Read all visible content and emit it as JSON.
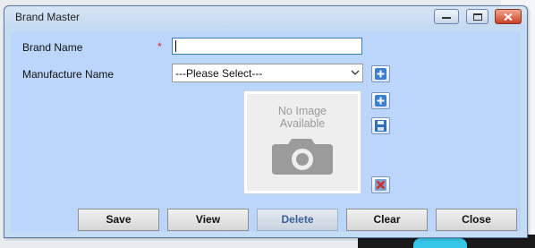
{
  "window": {
    "title": "Brand Master",
    "controls": [
      "minimize-icon",
      "maximize-icon",
      "close-icon"
    ]
  },
  "form": {
    "brand_name_label": "Brand Name",
    "required_marker": "*",
    "brand_name_value": "",
    "manufacture_label": "Manufacture Name",
    "manufacture_selected": "---Please Select---",
    "image_placeholder_line1": "No Image",
    "image_placeholder_line2": "Available"
  },
  "buttons": {
    "save": "Save",
    "view": "View",
    "delete": "Delete",
    "clear": "Clear",
    "close": "Close"
  },
  "colors": {
    "window_bg": "#c5dcf5",
    "client_bg": "#bcd6fb",
    "required": "#e02020",
    "textbox_focus_border": "#3c7fb1",
    "add_icon": "#3a7fd0",
    "delete_icon": "#d22b2b"
  }
}
